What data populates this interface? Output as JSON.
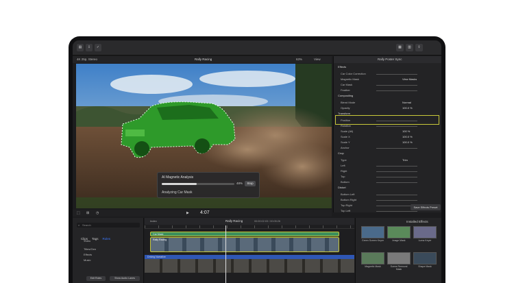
{
  "window": {
    "project_title": "Rally Racing",
    "zoom_level": "63%",
    "view_label": "View",
    "inspector_title": "Rally Poster Sync"
  },
  "viewer": {
    "format_label": "4K 25p, Stereo",
    "left_tags": [
      "HFR",
      "Analyze",
      "Idle"
    ]
  },
  "analysis_popup": {
    "title": "AI Magnetic Analysis",
    "percent": "48%",
    "stop_label": "Stop",
    "status": "Analyzing Car Mask",
    "progress": 0.48
  },
  "inspector": {
    "rows": [
      {
        "label": "Effects",
        "section": true
      },
      {
        "label": "Car Color Correction",
        "section": false
      },
      {
        "label": "Magnetic Mask",
        "value": "View Masks",
        "section": false
      },
      {
        "label": "Car Mask",
        "section": false
      },
      {
        "label": "Feather",
        "section": false
      },
      {
        "label": "Compositing",
        "section": true
      },
      {
        "label": "Blend Mode",
        "value": "Normal",
        "section": false
      },
      {
        "label": "Opacity",
        "value": "100.0 %",
        "section": false
      },
      {
        "label": "Transform",
        "section": true
      },
      {
        "label": "Position",
        "section": false
      },
      {
        "label": "Rotation",
        "section": false
      },
      {
        "label": "Scale (All)",
        "value": "100 %",
        "section": false
      },
      {
        "label": "Scale X",
        "value": "100.0 %",
        "section": false
      },
      {
        "label": "Scale Y",
        "value": "100.0 %",
        "section": false
      },
      {
        "label": "Anchor",
        "section": false
      },
      {
        "label": "Crop",
        "section": true
      },
      {
        "label": "Type",
        "value": "Trim",
        "section": false
      },
      {
        "label": "Left",
        "section": false
      },
      {
        "label": "Right",
        "section": false
      },
      {
        "label": "Top",
        "section": false
      },
      {
        "label": "Bottom",
        "section": false
      },
      {
        "label": "Distort",
        "section": true
      },
      {
        "label": "Bottom Left",
        "section": false
      },
      {
        "label": "Bottom Right",
        "section": false
      },
      {
        "label": "Top Right",
        "section": false
      },
      {
        "label": "Top Left",
        "section": false
      }
    ],
    "save_button": "Save Effects Preset"
  },
  "transport": {
    "timecode": "4:07"
  },
  "browser": {
    "search_placeholder": "Search",
    "tabs": [
      "Clips",
      "Tags",
      "Roles"
    ],
    "items": [
      "Video",
      "Titles/Gen",
      "Effects",
      "Music"
    ],
    "bottom_buttons": [
      "Edit Roles",
      "Show Audio Lanes"
    ]
  },
  "timeline": {
    "index_label": "Index",
    "project_label": "Rally Racing",
    "duration": "00:00:02:03 / 00:05:26",
    "top_clip_label": "Car Mask",
    "main_clip_label": "Rally Racing",
    "secondary_clip_label": "Driving Narrative"
  },
  "effects_browser": {
    "header": "Installed Effects",
    "items": [
      "Green Screen Keyer",
      "Image Mask",
      "Luma Keyer",
      "Magnetic Mask",
      "Scene Removal Mask",
      "Shape Mask"
    ]
  },
  "colors": {
    "mask_green": "#2e9a2a",
    "accent_blue": "#3b78ff",
    "selection_yellow": "#c9c93a",
    "clip_blue": "#2f57b5",
    "clip_green": "#3c8f5d"
  }
}
